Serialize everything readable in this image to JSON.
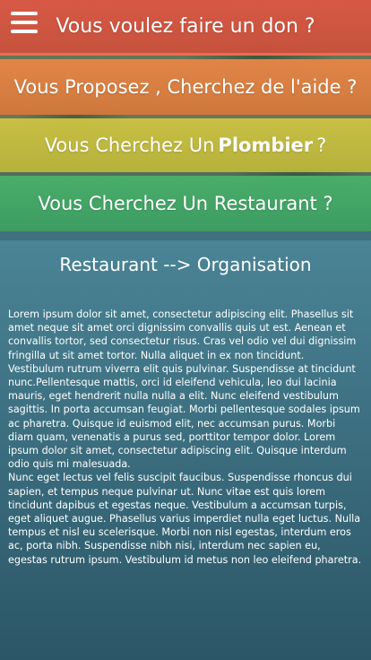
{
  "menu": {
    "icon": "hamburger-menu-icon"
  },
  "banners": {
    "donate": "Vous voulez faire un don ?",
    "help": "Vous Proposez , Cherchez de l'aide ?",
    "plumber_prefix": "Vous Cherchez Un",
    "plumber_bold": "Plombier",
    "plumber_suffix": "?",
    "restaurant": "Vous Cherchez Un Restaurant ?"
  },
  "content": {
    "title": "Restaurant --> Organisation",
    "paragraph1": "Lorem ipsum dolor sit amet, consectetur adipiscing elit. Phasellus sit amet neque sit amet orci dignissim convallis quis ut est. Aenean et convallis tortor, sed consectetur risus. Cras vel odio vel dui dignissim fringilla ut sit amet tortor. Nulla aliquet in ex non tincidunt. Vestibulum rutrum viverra elit quis pulvinar. Suspendisse at tincidunt nunc.Pellentesque mattis, orci id eleifend vehicula, leo dui lacinia mauris, eget hendrerit nulla nulla a elit. Nunc eleifend vestibulum sagittis. In porta accumsan feugiat. Morbi pellentesque sodales ipsum ac pharetra. Quisque id euismod elit, nec accumsan purus. Morbi diam quam, venenatis a purus sed, porttitor tempor dolor. Lorem ipsum dolor sit amet, consectetur adipiscing elit. Quisque interdum odio quis mi malesuada.",
    "paragraph2": "Nunc eget lectus vel felis suscipit faucibus. Suspendisse rhoncus dui sapien, et tempus neque pulvinar ut. Nunc vitae est quis lorem tincidunt dapibus et egestas neque. Vestibulum a accumsan turpis, eget aliquet augue. Phasellus varius imperdiet nulla eget luctus. Nulla tempus et nisl eu scelerisque. Morbi non nisl egestas, interdum eros ac, porta nibh. Suspendisse nibh nisi, interdum nec sapien eu, egestas rutrum ipsum. Vestibulum id metus non leo eleifend pharetra."
  }
}
